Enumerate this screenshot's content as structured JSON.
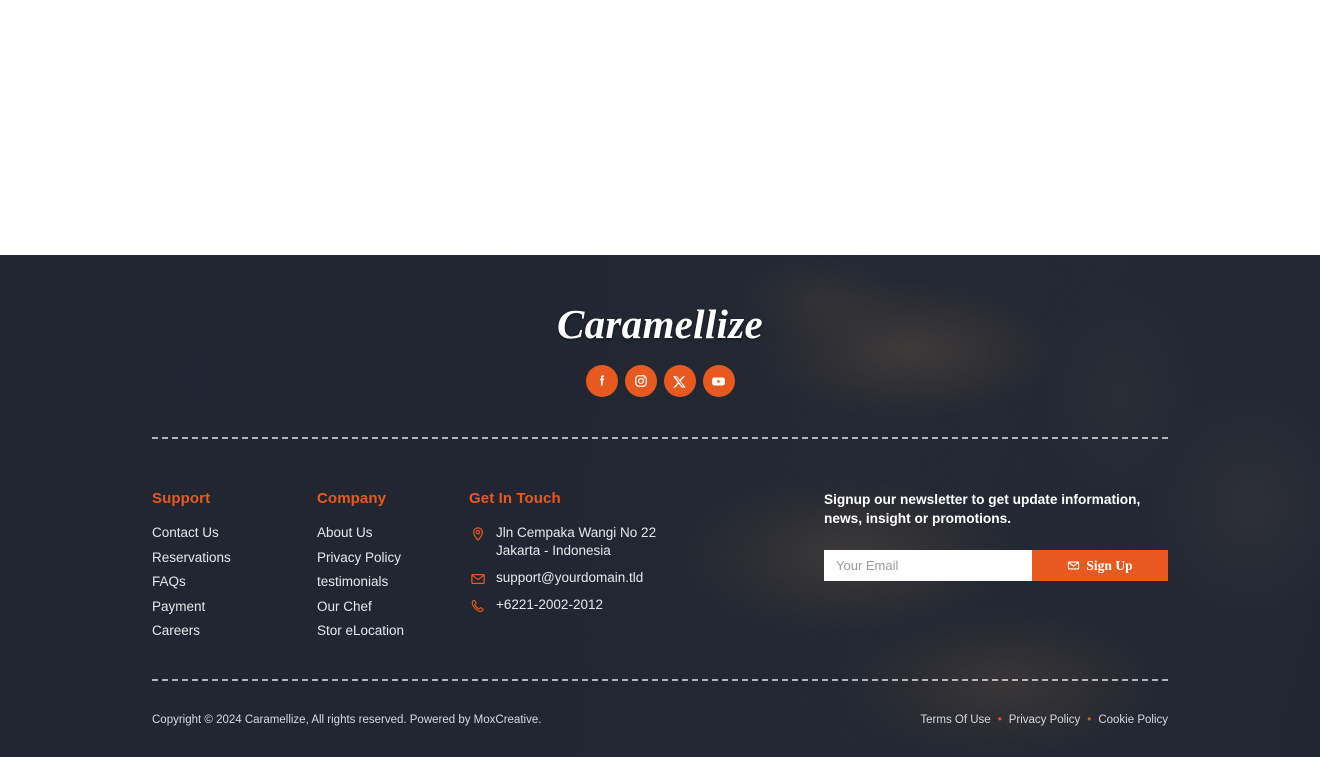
{
  "brand": {
    "logo_text": "Caramellize",
    "social": [
      {
        "name": "facebook",
        "label": "Facebook"
      },
      {
        "name": "instagram",
        "label": "Instagram"
      },
      {
        "name": "x-twitter",
        "label": "X"
      },
      {
        "name": "youtube",
        "label": "YouTube"
      }
    ]
  },
  "support": {
    "title": "Support",
    "links": [
      "Contact Us",
      "Reservations",
      "FAQs",
      "Payment",
      "Careers"
    ]
  },
  "company": {
    "title": "Company",
    "links": [
      "About Us",
      "Privacy Policy",
      "testimonials",
      "Our Chef",
      "Stor eLocation"
    ]
  },
  "get_in_touch": {
    "title": "Get In Touch",
    "address_line1": "Jln Cempaka Wangi No 22",
    "address_line2": "Jakarta - Indonesia",
    "email": "support@yourdomain.tld",
    "phone": "+6221-2002-2012"
  },
  "newsletter": {
    "text": "Signup our newsletter to get update information, news, insight or promotions.",
    "placeholder": "Your Email",
    "value": "",
    "button_label": "Sign Up"
  },
  "bottom": {
    "copyright": "Copyright © 2024 Caramellize, All rights reserved. Powered by MoxCreative.",
    "links": [
      "Terms Of Use",
      "Privacy Policy",
      "Cookie Policy"
    ],
    "separator": "•"
  },
  "colors": {
    "accent": "#e8591f",
    "footer_bg": "#232833",
    "text": "#e6e7ea",
    "white": "#ffffff"
  }
}
